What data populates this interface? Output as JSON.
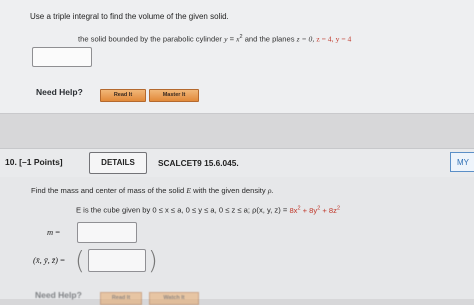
{
  "question_prev": {
    "prompt": "Use a triple integral to find the volume of the given solid.",
    "solid_text": "the solid bounded by the parabolic cylinder",
    "cylinder_lhs": "y",
    "cylinder_rhs_base": "x",
    "cylinder_rhs_exp": "2",
    "planes_text": "and the planes",
    "plane1": "z = 0,",
    "plane2": "z = 4,",
    "plane3": "y = 4",
    "answer_value": "",
    "need_help": "Need Help?",
    "read_it": "Read It",
    "master_it": "Master It"
  },
  "question": {
    "number_points": "10. [–1 Points]",
    "details_label": "DETAILS",
    "reference": "SCALCET9 15.6.045.",
    "my_label": "MY",
    "prompt_text": "Find the mass and center of mass of the solid",
    "prompt_var": "E",
    "prompt_text2": "with the given density",
    "prompt_rho": "ρ.",
    "cube_lead": "E is the cube given by 0 ≤ x ≤ a, 0 ≤ y ≤ a, 0 ≤ z ≤ a; ρ(x, y, z) =",
    "rho_t1": "8x",
    "rho_t2": " + 8y",
    "rho_t3": " + 8z",
    "rho_exp": "2",
    "m_label": "m",
    "m_value": "",
    "com_label": "(x̄, ȳ, z̄)",
    "com_value": "",
    "need_help": "Need Help?",
    "read_it": "Read It",
    "watch_it": "Watch It"
  }
}
